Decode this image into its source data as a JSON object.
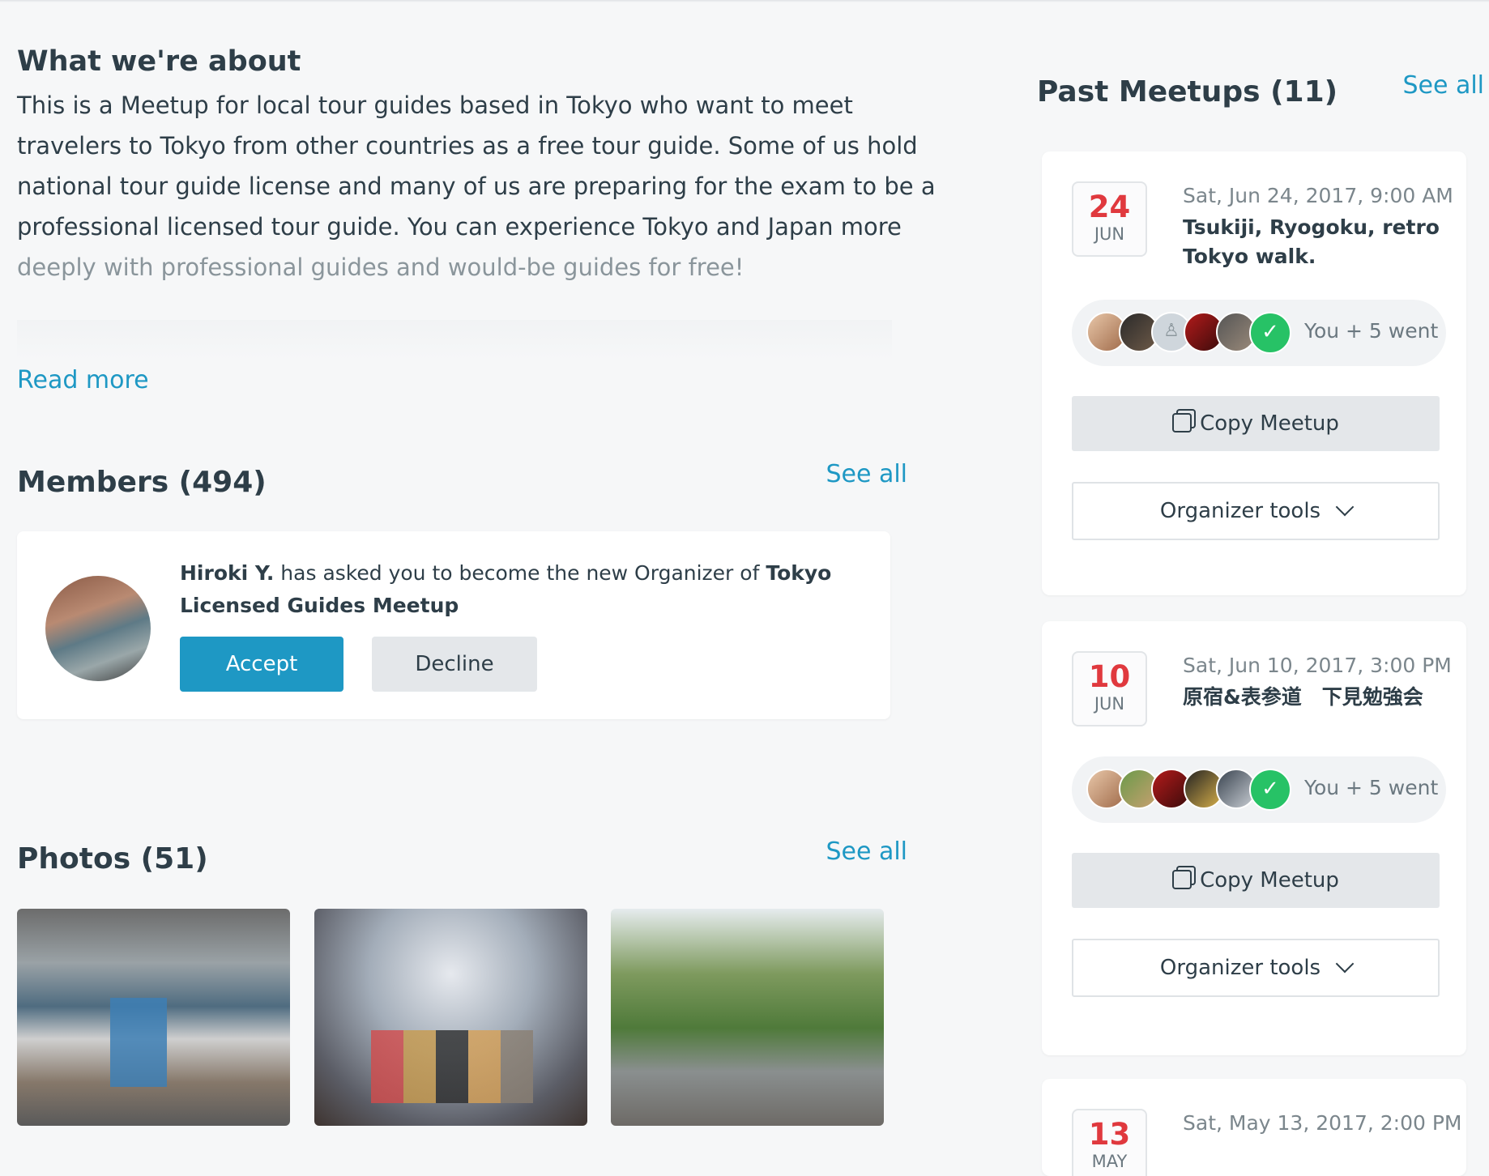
{
  "about": {
    "title": "What we're about",
    "lines": [
      "This is a Meetup for local tour guides based in Tokyo who want to meet",
      "travelers to Tokyo from other countries as a free tour guide. Some of us hold",
      "national tour guide license and many of us are preparing for the exam to be a",
      "professional licensed tour guide. You can experience Tokyo and Japan more",
      "deeply with professional guides and would-be guides for free!"
    ],
    "read_more": "Read more"
  },
  "members": {
    "title": "Members (494)",
    "see_all": "See all",
    "invite": {
      "name": "Hiroki Y.",
      "message": " has asked you to become the new Organizer of ",
      "group": "Tokyo Licensed Guides Meetup",
      "accept": "Accept",
      "decline": "Decline"
    }
  },
  "photos": {
    "title": "Photos (51)",
    "see_all": "See all"
  },
  "past": {
    "title": "Past Meetups (11)",
    "see_all": "See all",
    "meetups": [
      {
        "day": "24",
        "month": "JUN",
        "time": "Sat, Jun 24, 2017, 9:00 AM",
        "title": "Tsukiji, Ryogoku, retro Tokyo walk.",
        "attendance": "You + 5 went",
        "copy": "Copy Meetup",
        "organizer_tools": "Organizer tools"
      },
      {
        "day": "10",
        "month": "JUN",
        "time": "Sat, Jun 10, 2017, 3:00 PM",
        "title": "原宿&表参道　下見勉強会",
        "attendance": "You + 5 went",
        "copy": "Copy Meetup",
        "organizer_tools": "Organizer tools"
      },
      {
        "day": "13",
        "month": "MAY",
        "time": "Sat, May 13, 2017, 2:00 PM"
      }
    ]
  },
  "colors": {
    "accent": "#1e98c4",
    "date_red": "#e0393e",
    "check_green": "#27c266",
    "background": "#f6f7f8"
  }
}
